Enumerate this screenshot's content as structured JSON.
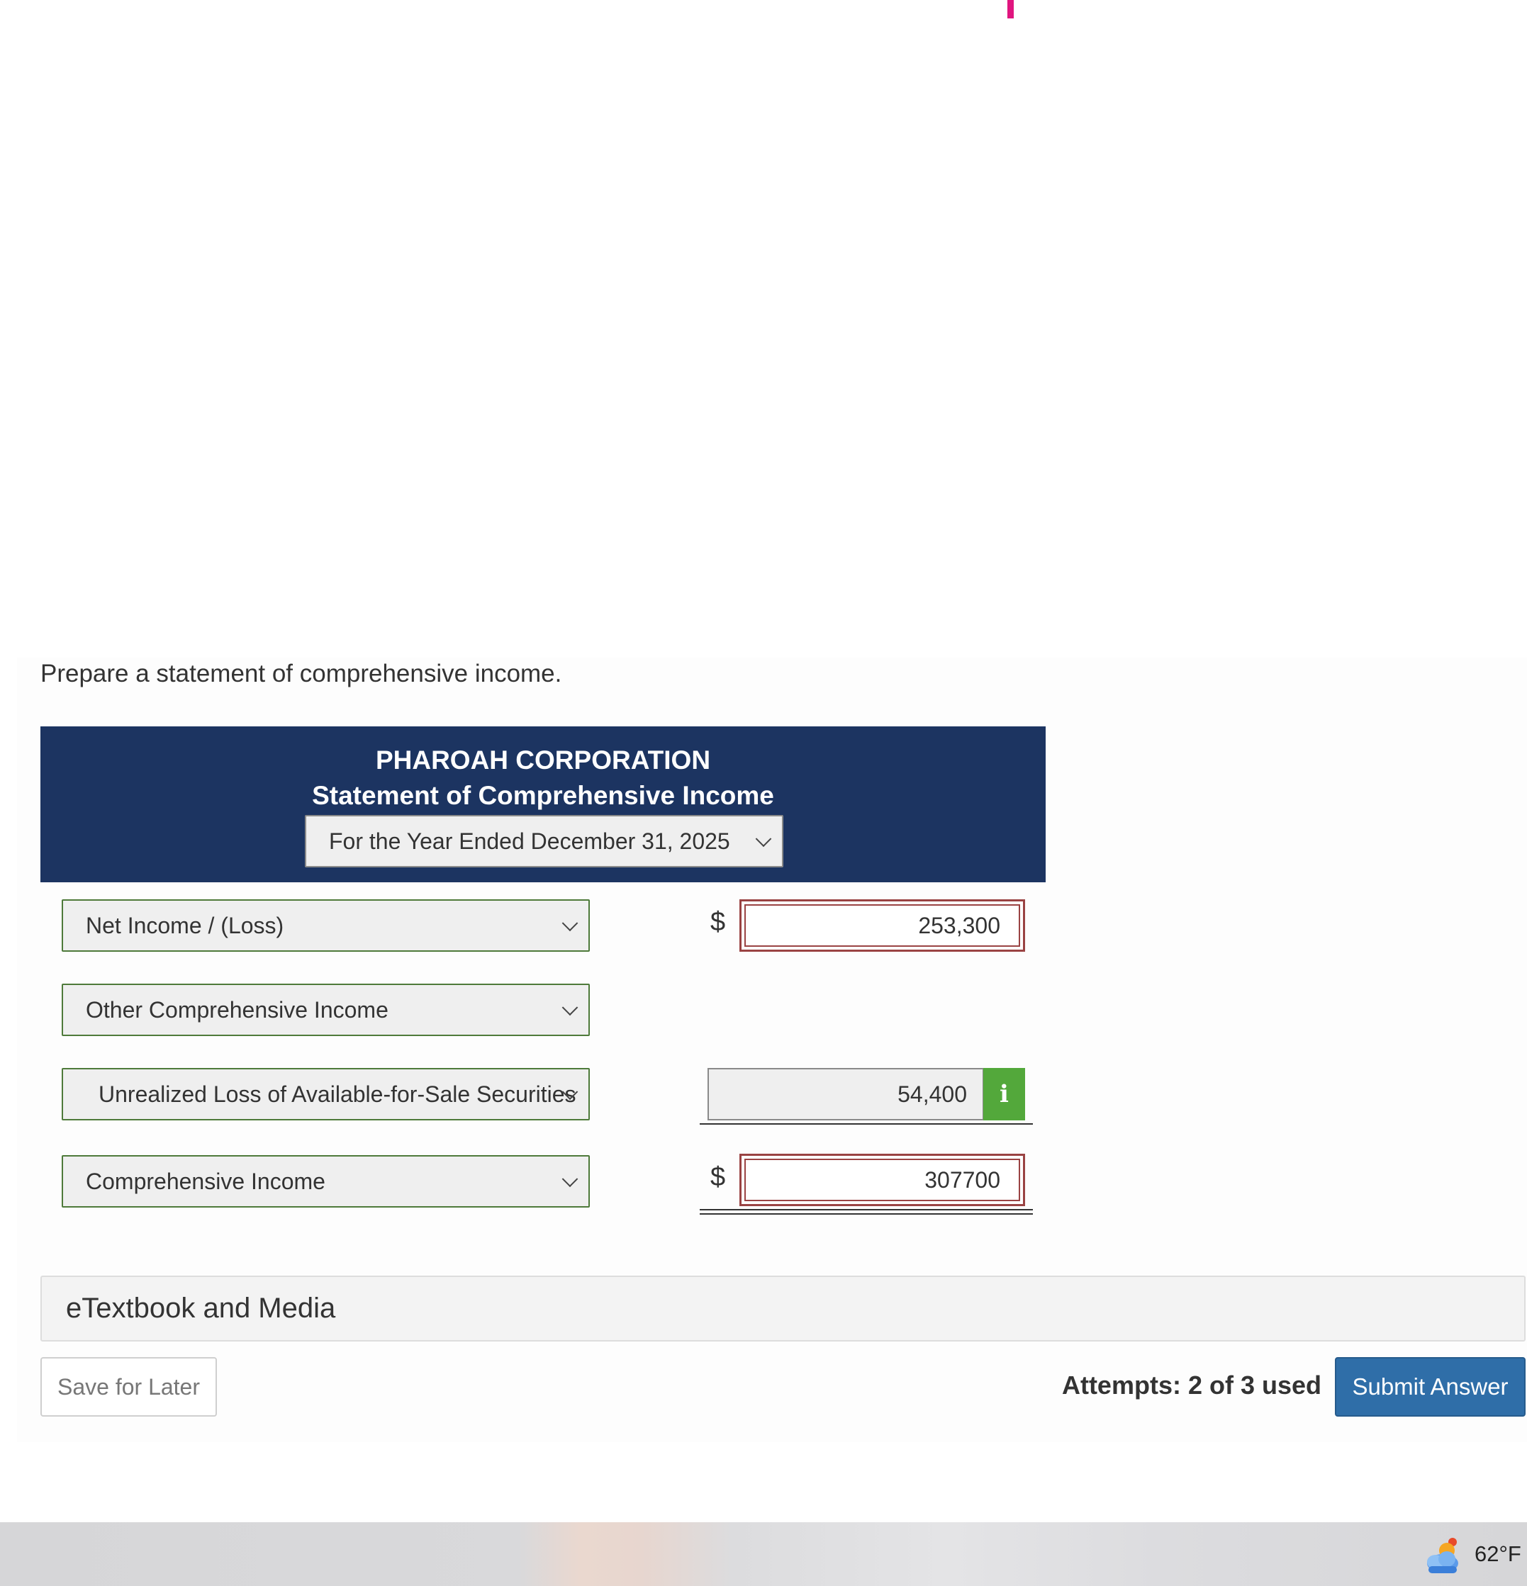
{
  "prompt": "Prepare a statement of comprehensive income.",
  "statement": {
    "company": "PHAROAH CORPORATION",
    "title": "Statement of Comprehensive Income",
    "period": "For the Year Ended December 31, 2025"
  },
  "rows": [
    {
      "label": "Net Income / (Loss)",
      "currency": "$",
      "value": "253,300"
    },
    {
      "label": "Other Comprehensive Income"
    },
    {
      "label": "Unrealized Loss of Available-for-Sale Securities",
      "value": "54,400",
      "info": "i"
    },
    {
      "label": "Comprehensive Income",
      "currency": "$",
      "value": "307700"
    }
  ],
  "etextbook_label": "eTextbook and Media",
  "save_label": "Save for Later",
  "attempts_label": "Attempts: 2 of 3 used",
  "submit_label": "Submit Answer",
  "taskbar": {
    "temperature": "62°F",
    "weather_icon": "partly-cloudy-icon"
  },
  "colors": {
    "header_bg": "#1c3461",
    "select_border": "#4e7a3a",
    "error_border": "#9a4343",
    "info_green": "#53a83b",
    "submit_blue": "#2f6ea8",
    "marker_pink": "#e0157f"
  }
}
